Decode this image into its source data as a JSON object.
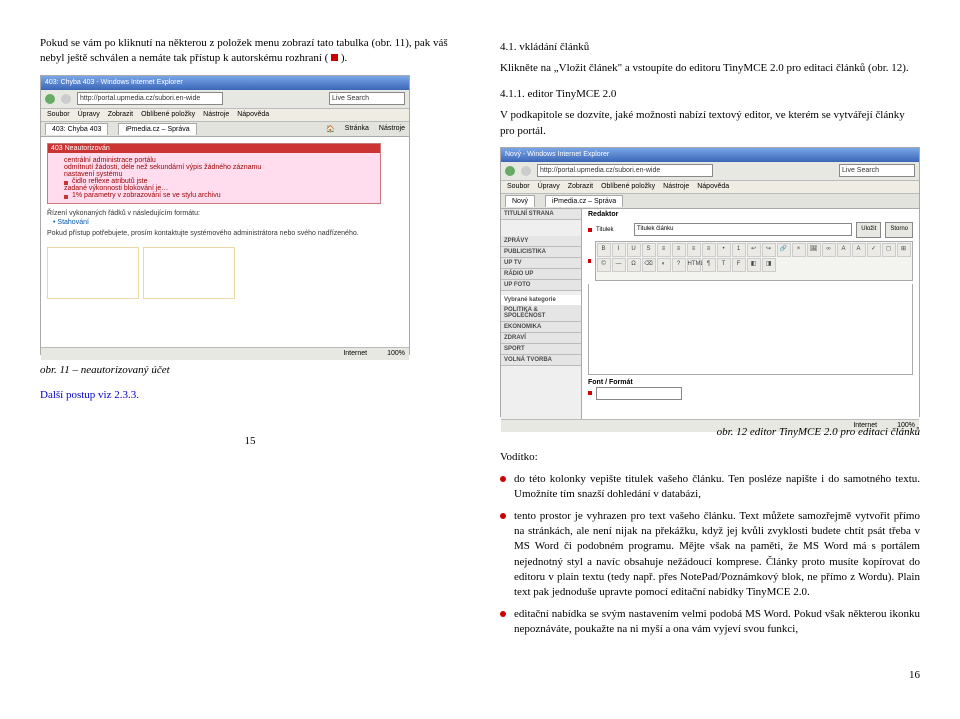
{
  "left": {
    "intro": "Pokud se vám po kliknutí na některou z položek menu zobrazí tato tabulka (obr. 11), pak váš nebyl ještě schválen a nemáte tak přístup k autorskému rozhraní (",
    "intro_end": ").",
    "caption11": "obr. 11 – neautorizovaný účet",
    "next_steps": "Další postup viz 2.3.3.",
    "page_num": "15",
    "ie_title": "403: Chyba 403 - Windows Internet Explorer",
    "addr": "http://portal.upmedia.cz/subori.en-wide",
    "tab1": "403: Chyba 403",
    "tab2": "iPmedia.cz – Správa",
    "menu": [
      "Soubor",
      "Úpravy",
      "Zobrazit",
      "Oblíbené položky",
      "Nástroje",
      "Nápověda"
    ],
    "rightmenu": [
      "Domů",
      "Stránka",
      "Nástroje"
    ],
    "err_title": "403 Neautorizován",
    "err_items": [
      "centrální administrace portálu",
      "odmítnutí žádosti, déle než sekundární výpis žádného záznamu",
      "nastavení systému",
      "čidlo reflexe atributů jste",
      "zadané výkonnosti blokování je…",
      "1% parametry v zobrazování se ve stylu archivu"
    ],
    "err_note1": "Řízení vykonaných řádků v následujícím formátu:",
    "err_note2": "• Stahování",
    "err_footer": "Pokud přístup potřebujete, prosím kontaktujte systémového administrátora nebo svého nadřízeného.",
    "status_zoom": "100%",
    "status_zone": "Internet"
  },
  "right": {
    "h1": "4.1. vkládání článků",
    "p1a": "Klikněte na „Vložit článek\" a vstoupíte do editoru TinyMCE 2.0 pro editaci článků (obr. 12).",
    "h2": "4.1.1. editor TinyMCE 2.0",
    "p2": "V podkapitole se dozvíte, jaké možnosti nabízí textový editor, ve kterém se vytvářejí články pro portál.",
    "caption12": "obr. 12 editor TinyMCE 2.0 pro editaci článků",
    "voditko": "Vodítko:",
    "bullets": [
      "do této kolonky vepište titulek vašeho článku. Ten posléze napište i do samotného textu. Umožníte tím snazší dohledání v databázi,",
      "tento prostor je vyhrazen pro text vašeho článku. Text můžete samozřejmě vytvořit přímo na stránkách, ale není nijak na překážku, když jej kvůli zvyklosti budete chtít psát třeba v MS Word či podobném programu. Mějte však na paměti, že MS Word má s portálem nejednotný styl a navíc obsahuje nežádoucí komprese. Články proto musíte kopírovat do editoru v plain textu (tedy např. přes NotePad/Poznámkový blok, ne přímo z Wordu). Plain text pak jednoduše upravte pomocí editační nabídky TinyMCE 2.0.",
      "editační nabídka se svým nastavením velmi podobá MS Word. Pokud však některou ikonku nepoznáváte, poukažte na ni myší a ona vám vyjeví svou funkci,"
    ],
    "page_num": "16",
    "ie_title": "Nový - Windows Internet Explorer",
    "addr": "http://portal.upmedia.cz/subori.en-wide",
    "tab1": "Nový",
    "tab2": "iPmedia.cz – Správa",
    "sidebar": [
      "TITULNÍ STRANA",
      "ZPRÁVY",
      "PUBLICISTIKA",
      "UP TV",
      "RÁDIO UP",
      "UP FOTO",
      "Vybrané kategorie",
      "POLITIKA & SPOLEČNOST",
      "EKONOMIKA",
      "ZDRAVÍ",
      "SPORT",
      "VOLNÁ TVORBA"
    ],
    "editor_header": "Redaktor",
    "title_label": "Titulek",
    "title_value": "Titulek článku",
    "btn1": "Uložit",
    "btn2": "Storno",
    "mce_buttons": [
      "B",
      "I",
      "U",
      "S",
      "≡",
      "≡",
      "≡",
      "≡",
      "•",
      "1",
      "↩",
      "↪",
      "🔗",
      "×",
      "🖼",
      "∞",
      "A",
      "A",
      "✓",
      "◻",
      "⊞",
      "©",
      "—",
      "Ω",
      "⌫",
      "◐",
      "?",
      "HTML",
      "¶",
      "T",
      "F",
      "◧",
      "◨"
    ],
    "font_label": "Font / Formát",
    "status_zone": "Internet",
    "status_zoom": "100%"
  }
}
